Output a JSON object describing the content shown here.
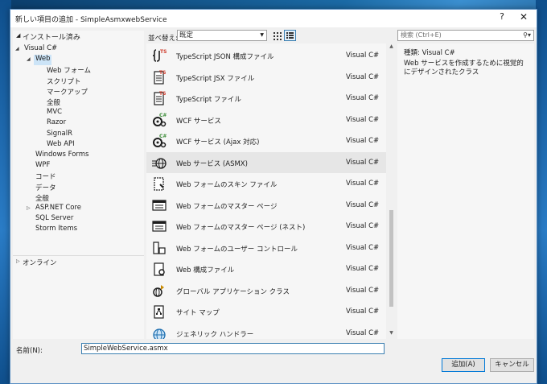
{
  "window": {
    "title": "新しい項目の追加 - SimpleAsmxwebService",
    "help_label": "?",
    "close_label": "✕"
  },
  "tree": {
    "header": "インストール済み",
    "items": [
      {
        "label": "Visual C#",
        "level": 1,
        "expanded": true
      },
      {
        "label": "Web",
        "level": 2,
        "expanded": true,
        "selected": true
      },
      {
        "label": "Web フォーム",
        "level": 3
      },
      {
        "label": "スクリプト",
        "level": 3
      },
      {
        "label": "マークアップ",
        "level": 3
      },
      {
        "label": "全般",
        "level": 3
      },
      {
        "label": "MVC",
        "level": 3
      },
      {
        "label": "Razor",
        "level": 3
      },
      {
        "label": "SignalR",
        "level": 3
      },
      {
        "label": "Web API",
        "level": 3
      },
      {
        "label": "Windows Forms",
        "level": 2
      },
      {
        "label": "WPF",
        "level": 2
      },
      {
        "label": "コード",
        "level": 2
      },
      {
        "label": "データ",
        "level": 2
      },
      {
        "label": "全般",
        "level": 2
      },
      {
        "label": "ASP.NET Core",
        "level": 2,
        "collapsed": true
      },
      {
        "label": "SQL Server",
        "level": 2
      },
      {
        "label": "Storm Items",
        "level": 2
      }
    ],
    "online": "オンライン"
  },
  "toolbar": {
    "sort_label": "並べ替え:",
    "sort_value": "既定",
    "search_placeholder": "検索 (Ctrl+E)"
  },
  "list": {
    "items": [
      {
        "name": "TypeScript JSON 構成ファイル",
        "lang": "Visual C#",
        "icon": "typescript-json-icon"
      },
      {
        "name": "TypeScript JSX ファイル",
        "lang": "Visual C#",
        "icon": "typescript-file-icon"
      },
      {
        "name": "TypeScript ファイル",
        "lang": "Visual C#",
        "icon": "typescript-file-icon"
      },
      {
        "name": "WCF サービス",
        "lang": "Visual C#",
        "icon": "wcf-service-icon"
      },
      {
        "name": "WCF サービス (Ajax 対応)",
        "lang": "Visual C#",
        "icon": "wcf-service-icon"
      },
      {
        "name": "Web サービス (ASMX)",
        "lang": "Visual C#",
        "icon": "web-service-asmx-icon",
        "selected": true
      },
      {
        "name": "Web フォームのスキン ファイル",
        "lang": "Visual C#",
        "icon": "skin-file-icon"
      },
      {
        "name": "Web フォームのマスター ページ",
        "lang": "Visual C#",
        "icon": "master-page-icon"
      },
      {
        "name": "Web フォームのマスター ページ (ネスト)",
        "lang": "Visual C#",
        "icon": "master-page-icon"
      },
      {
        "name": "Web フォームのユーザー コントロール",
        "lang": "Visual C#",
        "icon": "user-control-icon"
      },
      {
        "name": "Web 構成ファイル",
        "lang": "Visual C#",
        "icon": "config-file-icon"
      },
      {
        "name": "グローバル アプリケーション クラス",
        "lang": "Visual C#",
        "icon": "global-class-icon"
      },
      {
        "name": "サイト マップ",
        "lang": "Visual C#",
        "icon": "site-map-icon"
      },
      {
        "name": "ジェネリック ハンドラー",
        "lang": "Visual C#",
        "icon": "generic-handler-icon"
      }
    ]
  },
  "details": {
    "type_label": "種類:",
    "type_value": "Visual C#",
    "description": "Web サービスを作成するために視覚的にデザインされたクラス"
  },
  "footer": {
    "name_label": "名前(N):",
    "name_value": "SimpleWebService.asmx",
    "add_label": "追加(A)",
    "cancel_label": "キャンセル"
  },
  "colors": {
    "selection": "#cce4f7",
    "list_selection": "#e6e6e6",
    "accent": "#0078d7"
  }
}
